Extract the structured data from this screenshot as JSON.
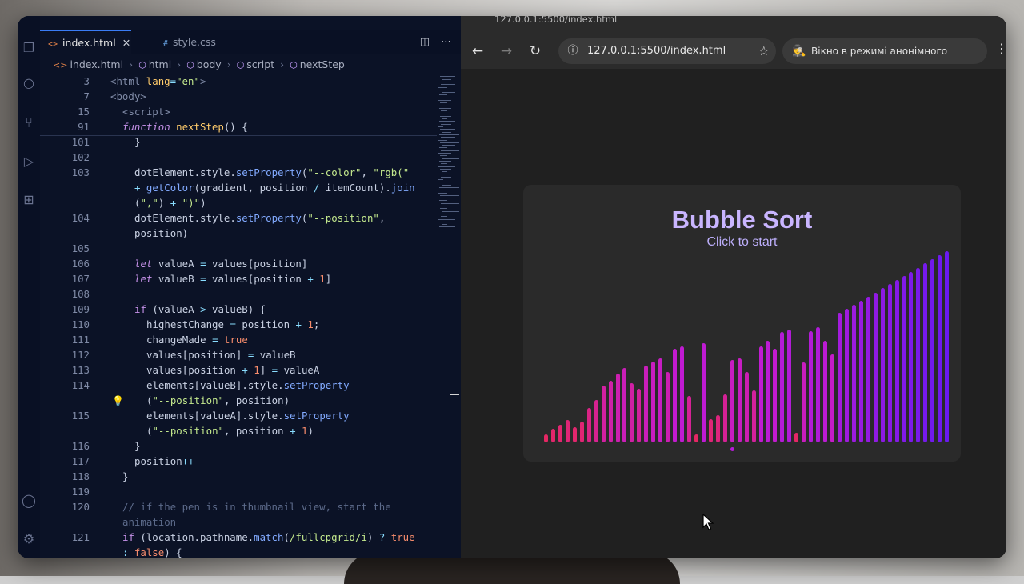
{
  "vscode": {
    "tabs": [
      {
        "label": "index.html",
        "icon": "html-file-icon",
        "active": true
      },
      {
        "label": "style.css",
        "icon": "css-file-icon",
        "active": false
      }
    ],
    "breadcrumb": [
      "index.html",
      "html",
      "body",
      "script",
      "nextStep"
    ],
    "lines": [
      {
        "n": "3",
        "indent": 0,
        "tokens": [
          [
            "tag",
            "<"
          ],
          [
            "tag",
            "html "
          ],
          [
            "attr",
            "lang"
          ],
          [
            "op",
            "="
          ],
          [
            "str",
            "\"en\""
          ],
          [
            "tag",
            ">"
          ]
        ]
      },
      {
        "n": "7",
        "indent": 0,
        "tokens": [
          [
            "tag",
            "<body>"
          ]
        ]
      },
      {
        "n": "15",
        "indent": 1,
        "tokens": [
          [
            "tag",
            "<script>"
          ]
        ]
      },
      {
        "n": "91",
        "indent": 1,
        "tokens": [
          [
            "kwi",
            "function "
          ],
          [
            "fny",
            "nextStep"
          ],
          [
            "var",
            "() {"
          ]
        ]
      },
      {
        "n": "101",
        "indent": 2,
        "tokens": [
          [
            "var",
            "}"
          ]
        ]
      },
      {
        "n": "102",
        "indent": 2,
        "tokens": []
      },
      {
        "n": "103",
        "indent": 2,
        "tokens": [
          [
            "var",
            "dotElement.style."
          ],
          [
            "fn",
            "setProperty"
          ],
          [
            "var",
            "("
          ],
          [
            "str",
            "\"--color\""
          ],
          [
            "var",
            ", "
          ],
          [
            "str",
            "\"rgb(\""
          ]
        ]
      },
      {
        "n": "",
        "indent": 2,
        "tokens": [
          [
            "op",
            "+ "
          ],
          [
            "fn",
            "getColor"
          ],
          [
            "var",
            "(gradient, position "
          ],
          [
            "op",
            "/ "
          ],
          [
            "var",
            "itemCount)."
          ],
          [
            "fn",
            "join"
          ]
        ]
      },
      {
        "n": "",
        "indent": 2,
        "tokens": [
          [
            "var",
            "("
          ],
          [
            "str",
            "\",\""
          ],
          [
            "var",
            ") "
          ],
          [
            "op",
            "+ "
          ],
          [
            "str",
            "\")\""
          ],
          [
            "var",
            ")"
          ]
        ]
      },
      {
        "n": "104",
        "indent": 2,
        "tokens": [
          [
            "var",
            "dotElement.style."
          ],
          [
            "fn",
            "setProperty"
          ],
          [
            "var",
            "("
          ],
          [
            "str",
            "\"--position\""
          ],
          [
            "var",
            ","
          ]
        ]
      },
      {
        "n": "",
        "indent": 2,
        "tokens": [
          [
            "var",
            "position)"
          ]
        ]
      },
      {
        "n": "105",
        "indent": 2,
        "tokens": []
      },
      {
        "n": "106",
        "indent": 2,
        "tokens": [
          [
            "kwi",
            "let "
          ],
          [
            "var",
            "valueA "
          ],
          [
            "op",
            "= "
          ],
          [
            "var",
            "values[position]"
          ]
        ]
      },
      {
        "n": "107",
        "indent": 2,
        "tokens": [
          [
            "kwi",
            "let "
          ],
          [
            "var",
            "valueB "
          ],
          [
            "op",
            "= "
          ],
          [
            "var",
            "values[position "
          ],
          [
            "op",
            "+ "
          ],
          [
            "num",
            "1"
          ],
          [
            "var",
            "]"
          ]
        ]
      },
      {
        "n": "108",
        "indent": 2,
        "tokens": []
      },
      {
        "n": "109",
        "indent": 2,
        "tokens": [
          [
            "kw",
            "if "
          ],
          [
            "var",
            "(valueA "
          ],
          [
            "op",
            "> "
          ],
          [
            "var",
            "valueB) {"
          ]
        ]
      },
      {
        "n": "110",
        "indent": 3,
        "tokens": [
          [
            "var",
            "highestChange "
          ],
          [
            "op",
            "= "
          ],
          [
            "var",
            "position "
          ],
          [
            "op",
            "+ "
          ],
          [
            "num",
            "1"
          ],
          [
            "var",
            ";"
          ]
        ]
      },
      {
        "n": "111",
        "indent": 3,
        "tokens": [
          [
            "var",
            "changeMade "
          ],
          [
            "op",
            "= "
          ],
          [
            "num",
            "true"
          ]
        ]
      },
      {
        "n": "112",
        "indent": 3,
        "tokens": [
          [
            "var",
            "values[position] "
          ],
          [
            "op",
            "= "
          ],
          [
            "var",
            "valueB"
          ]
        ]
      },
      {
        "n": "113",
        "indent": 3,
        "tokens": [
          [
            "var",
            "values[position "
          ],
          [
            "op",
            "+ "
          ],
          [
            "num",
            "1"
          ],
          [
            "var",
            "] "
          ],
          [
            "op",
            "= "
          ],
          [
            "var",
            "valueA"
          ]
        ]
      },
      {
        "n": "114",
        "indent": 3,
        "tokens": [
          [
            "var",
            "elements[valueB].style."
          ],
          [
            "fn",
            "setProperty"
          ]
        ]
      },
      {
        "n": "",
        "indent": 3,
        "tokens": [
          [
            "var",
            "("
          ],
          [
            "str",
            "\"--position\""
          ],
          [
            "var",
            ", position)"
          ]
        ]
      },
      {
        "n": "115",
        "indent": 3,
        "tokens": [
          [
            "var",
            "elements[valueA].style."
          ],
          [
            "fn",
            "setProperty"
          ]
        ]
      },
      {
        "n": "",
        "indent": 3,
        "tokens": [
          [
            "var",
            "("
          ],
          [
            "str",
            "\"--position\""
          ],
          [
            "var",
            ", position "
          ],
          [
            "op",
            "+ "
          ],
          [
            "num",
            "1"
          ],
          [
            "var",
            ")"
          ]
        ]
      },
      {
        "n": "116",
        "indent": 2,
        "tokens": [
          [
            "var",
            "}"
          ]
        ]
      },
      {
        "n": "117",
        "indent": 2,
        "tokens": [
          [
            "var",
            "position"
          ],
          [
            "op",
            "++"
          ]
        ]
      },
      {
        "n": "118",
        "indent": 1,
        "tokens": [
          [
            "var",
            "}"
          ]
        ]
      },
      {
        "n": "119",
        "indent": 1,
        "tokens": []
      },
      {
        "n": "120",
        "indent": 1,
        "tokens": [
          [
            "cm",
            "// if the pen is in thumbnail view, start the"
          ]
        ]
      },
      {
        "n": "",
        "indent": 1,
        "tokens": [
          [
            "cm",
            "animation"
          ]
        ]
      },
      {
        "n": "121",
        "indent": 1,
        "tokens": [
          [
            "kw",
            "if "
          ],
          [
            "var",
            "(location.pathname."
          ],
          [
            "fn",
            "match"
          ],
          [
            "var",
            "("
          ],
          [
            "str",
            "/fullcpgrid/i"
          ],
          [
            "var",
            ") "
          ],
          [
            "op",
            "? "
          ],
          [
            "num",
            "true"
          ]
        ]
      },
      {
        "n": "",
        "indent": 1,
        "tokens": [
          [
            "op",
            ": "
          ],
          [
            "num",
            "false"
          ],
          [
            "var",
            ") {"
          ]
        ]
      }
    ]
  },
  "browser": {
    "tab_title": "127.0.0.1:5500/index.html",
    "url": "127.0.0.1:5500/index.html",
    "incognito_label": "Вікно в режимі анонімного перегляду",
    "page": {
      "title": "Bubble Sort",
      "subtitle": "Click to start"
    }
  },
  "bubble_values": [
    6,
    10,
    13,
    16,
    11,
    15,
    25,
    31,
    41,
    45,
    50,
    54,
    43,
    39,
    56,
    59,
    61,
    51,
    68,
    70,
    34,
    6,
    72,
    17,
    20,
    35,
    60,
    61,
    51,
    38,
    70,
    74,
    68,
    80,
    82,
    7,
    58,
    81,
    84,
    74,
    64,
    94,
    97,
    100,
    103,
    106,
    109,
    112,
    115,
    118,
    121,
    124,
    127,
    130,
    133,
    136,
    139
  ],
  "colors": {
    "gradient_start": "#e8285a",
    "gradient_mid": "#c21bd2",
    "gradient_end": "#6a1af0",
    "title": "#c9b5ff"
  }
}
